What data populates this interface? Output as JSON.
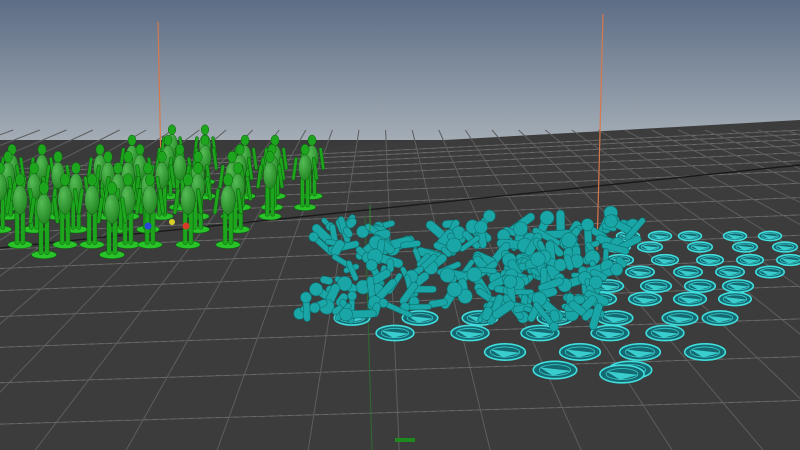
{
  "viewport": {
    "sky_top": "#5d6d85",
    "sky_bottom": "#a4adb6",
    "floor_color": "#3c3c3c",
    "grid_color": "#5e5e5e",
    "grid_dash_color": "#8a8a8a",
    "x_axis_color": "#1a1a1a",
    "pivot_line_color": "#d8774a",
    "standing_agent_color": "#1ea51e",
    "fallen_agent_color": "#1aa6a6",
    "marker_color": "#41dede"
  },
  "scene": {
    "standing_agents": 40,
    "fallen_agents": 210,
    "footprint_markers": 48,
    "pivot_lines": 2
  }
}
